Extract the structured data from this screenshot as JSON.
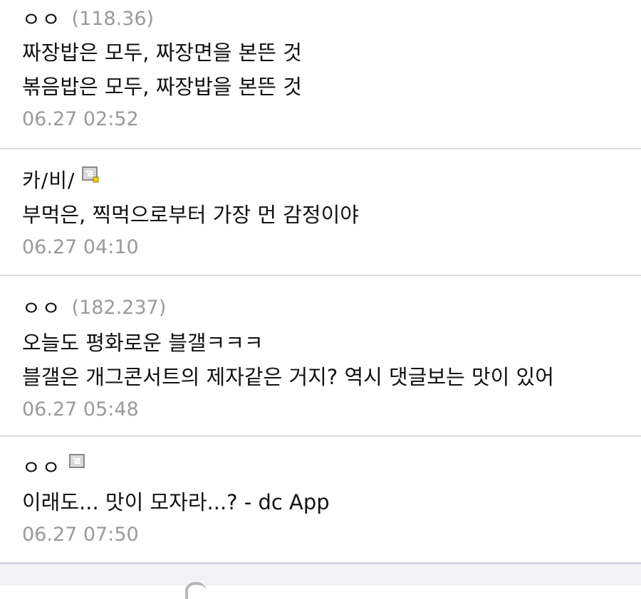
{
  "comments": [
    {
      "nickname": "ㅇㅇ",
      "ip": "(118.36)",
      "lines": [
        "짜장밥은 모두, 짜장면을 본뜬 것",
        "볶음밥은 모두, 짜장밥을 본뜬 것"
      ],
      "date": "06.27 02:52"
    },
    {
      "nickname": "카/비/",
      "icon": "gallog-fixed-icon",
      "lines": [
        "부먹은, 찍먹으로부터 가장 먼 감정이야"
      ],
      "date": "06.27 04:10"
    },
    {
      "nickname": "ㅇㅇ",
      "ip": "(182.237)",
      "lines": [
        "오늘도 평화로운 블갤ㅋㅋㅋ",
        "블갤은 개그콘서트의 제자같은 거지? 역시 댓글보는 맛이 있어"
      ],
      "date": "06.27 05:48"
    },
    {
      "nickname": "ㅇㅇ",
      "icon": "gallog-half-icon",
      "lines": [
        "이래도... 맛이 모자라...? - dc App"
      ],
      "date": "06.27 07:50"
    }
  ],
  "colors": {
    "ip": "#9a9a9a",
    "date": "#9a9a9a",
    "divider": "#dcdcdc",
    "footer_border": "#c9c9e6"
  }
}
